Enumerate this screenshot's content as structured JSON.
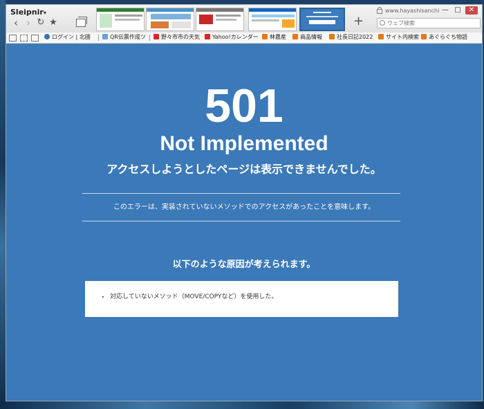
{
  "browser": {
    "name": "Sleipnir",
    "menu_caret": "▾",
    "url": "www.hayashisanchi...",
    "search_placeholder": "ウェブ検索",
    "new_tab_label": "+",
    "window_controls": {
      "minimize": "—",
      "maximize": "□",
      "close": "✕"
    },
    "nav_icons": {
      "back": "back-icon",
      "forward": "forward-icon",
      "reload": "reload-icon",
      "favorite": "star-icon"
    }
  },
  "bookmarks": [
    {
      "label": "ログイン | 北國",
      "icon_color": "#3a6fb5"
    },
    {
      "label": "QR伝票作成ツ",
      "icon_color": "#6aa0d8"
    },
    {
      "label": "野々市市の天気",
      "icon_color": "#d8262a"
    },
    {
      "label": "Yahoo!カレンダー",
      "icon_color": "#d8262a"
    },
    {
      "label": "林農産",
      "icon_color": "#e07b14"
    },
    {
      "label": "商品情報",
      "icon_color": "#e07b14"
    },
    {
      "label": "社長日記2022",
      "icon_color": "#e07b14"
    },
    {
      "label": "サイト内検索",
      "icon_color": "#e07b14"
    },
    {
      "label": "あぐらぐち物語",
      "icon_color": "#e07b14"
    }
  ],
  "error_page": {
    "code": "501",
    "title": "Not Implemented",
    "subtitle": "アクセスしようとしたページは表示できませんでした。",
    "description": "このエラーは、実装されていないメソッドでのアクセスがあったことを意味します。",
    "causes_heading": "以下のような原因が考えられます。",
    "causes": [
      "対応していないメソッド（MOVE/COPYなど）を使用した。"
    ]
  },
  "colors": {
    "page_background": "#3b79b8",
    "text": "#ffffff"
  }
}
